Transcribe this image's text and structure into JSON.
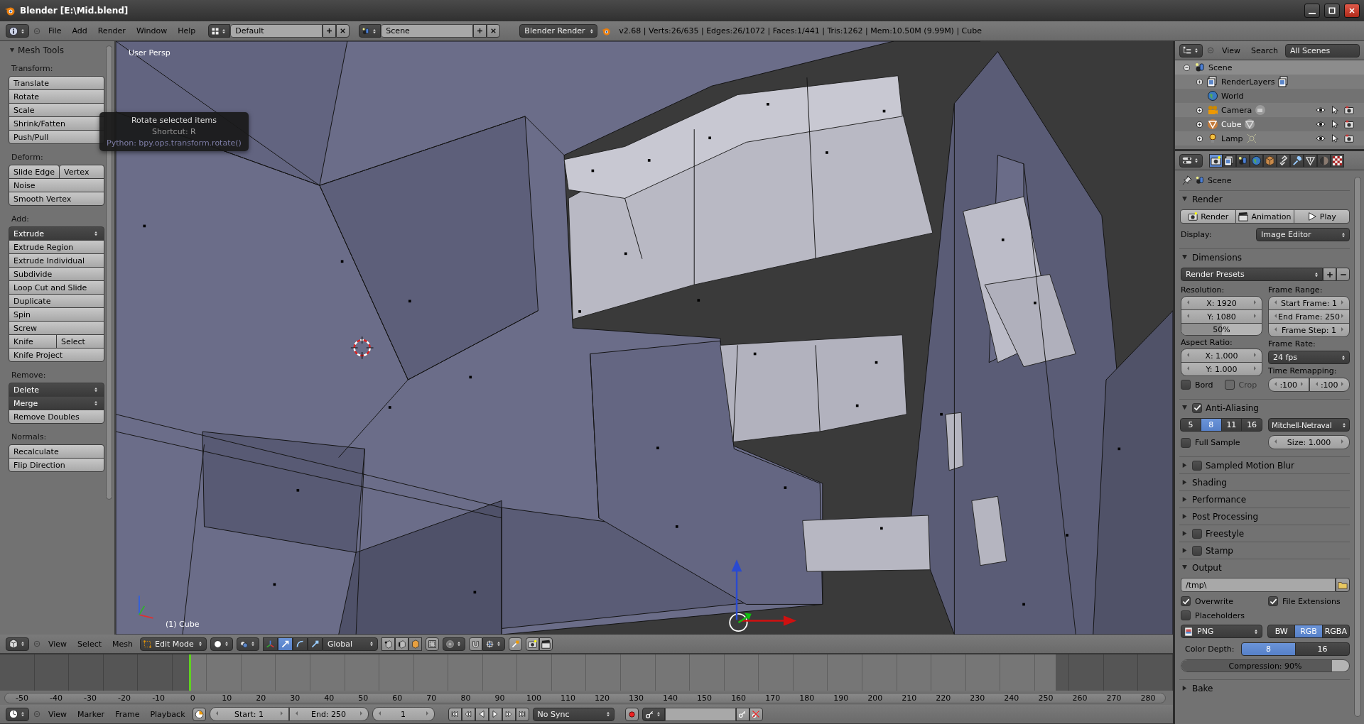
{
  "window": {
    "title": "Blender [E:\\Mid.blend]"
  },
  "info_header": {
    "menus": [
      "File",
      "Add",
      "Render",
      "Window",
      "Help"
    ],
    "layout": "Default",
    "scene": "Scene",
    "engine": "Blender Render",
    "stats": "v2.68 | Verts:26/635 | Edges:26/1072 | Faces:1/441 | Tris:1262 | Mem:10.50M (9.99M) | Cube"
  },
  "tool_shelf": {
    "title": "Mesh Tools",
    "sections": [
      {
        "label": "Transform:",
        "rows": [
          [
            {
              "label": "Translate",
              "kind": "button"
            }
          ],
          [
            {
              "label": "Rotate",
              "kind": "button"
            }
          ],
          [
            {
              "label": "Scale",
              "kind": "button"
            }
          ],
          [
            {
              "label": "Shrink/Fatten",
              "kind": "button"
            }
          ],
          [
            {
              "label": "Push/Pull",
              "kind": "button"
            }
          ]
        ]
      },
      {
        "label": "Deform:",
        "rows": [
          [
            {
              "label": "Slide Edge",
              "kind": "button"
            },
            {
              "label": "Vertex",
              "kind": "button"
            }
          ],
          [
            {
              "label": "Noise",
              "kind": "button"
            }
          ],
          [
            {
              "label": "Smooth Vertex",
              "kind": "button"
            }
          ]
        ]
      },
      {
        "label": "Add:",
        "rows": [
          [
            {
              "label": "Extrude",
              "kind": "dropdown"
            }
          ],
          [
            {
              "label": "Extrude Region",
              "kind": "button"
            }
          ],
          [
            {
              "label": "Extrude Individual",
              "kind": "button"
            }
          ],
          [
            {
              "label": "Subdivide",
              "kind": "button"
            }
          ],
          [
            {
              "label": "Loop Cut and Slide",
              "kind": "button"
            }
          ],
          [
            {
              "label": "Duplicate",
              "kind": "button"
            }
          ],
          [
            {
              "label": "Spin",
              "kind": "button"
            }
          ],
          [
            {
              "label": "Screw",
              "kind": "button"
            }
          ],
          [
            {
              "label": "Knife",
              "kind": "button"
            },
            {
              "label": "Select",
              "kind": "button"
            }
          ],
          [
            {
              "label": "Knife Project",
              "kind": "button"
            }
          ]
        ]
      },
      {
        "label": "Remove:",
        "rows": [
          [
            {
              "label": "Delete",
              "kind": "dropdown"
            }
          ],
          [
            {
              "label": "Merge",
              "kind": "dropdown"
            }
          ],
          [
            {
              "label": "Remove Doubles",
              "kind": "button"
            }
          ]
        ]
      },
      {
        "label": "Normals:",
        "rows": [
          [
            {
              "label": "Recalculate",
              "kind": "button"
            }
          ],
          [
            {
              "label": "Flip Direction",
              "kind": "button"
            }
          ]
        ]
      }
    ]
  },
  "tooltip": {
    "title": "Rotate selected items",
    "shortcut": "Shortcut: R",
    "python": "Python: bpy.ops.transform.rotate()"
  },
  "viewport": {
    "view_label": "User Persp",
    "object_label": "(1) Cube"
  },
  "viewport_header": {
    "menus": [
      "View",
      "Select",
      "Mesh"
    ],
    "mode": "Edit Mode",
    "orientation": "Global",
    "manipulators": [
      {
        "kind": "toggle",
        "selected": false
      },
      {
        "kind": "translate",
        "selected": true
      },
      {
        "kind": "rotate",
        "selected": false
      },
      {
        "kind": "scale",
        "selected": false
      }
    ],
    "select_modes": [
      {
        "kind": "vertex",
        "selected": false
      },
      {
        "kind": "edge",
        "selected": false
      },
      {
        "kind": "face",
        "selected": true
      }
    ]
  },
  "timeline": {
    "playhead": {
      "level": 0.162
    },
    "ticks": [
      "-50",
      "-40",
      "-30",
      "-20",
      "-10",
      "0",
      "10",
      "20",
      "30",
      "40",
      "50",
      "60",
      "70",
      "80",
      "90",
      "100",
      "110",
      "120",
      "130",
      "140",
      "150",
      "160",
      "170",
      "180",
      "190",
      "200",
      "210",
      "220",
      "230",
      "240",
      "250",
      "260",
      "270",
      "280"
    ]
  },
  "timeline_header": {
    "menus": [
      "View",
      "Marker",
      "Frame",
      "Playback"
    ],
    "start": "Start: 1",
    "end": "End: 250",
    "current": "1",
    "sync": "No Sync"
  },
  "outliner": {
    "menus": [
      "View",
      "Search"
    ],
    "filter": "All Scenes",
    "tree": [
      {
        "label": "Scene",
        "kind": "scene",
        "expanded": true,
        "children": [
          {
            "label": "RenderLayers",
            "kind": "render_layers",
            "expanded": false
          },
          {
            "label": "World",
            "kind": "world"
          },
          {
            "label": "Camera",
            "kind": "camera",
            "expanded": false
          },
          {
            "label": "Cube",
            "kind": "mesh",
            "expanded": false
          },
          {
            "label": "Lamp",
            "kind": "lamp",
            "expanded": false
          }
        ]
      }
    ]
  },
  "properties": {
    "context": "Scene",
    "tabs": [
      {
        "kind": "render",
        "selected": true
      },
      {
        "kind": "layers",
        "selected": false
      },
      {
        "kind": "scene",
        "selected": false
      },
      {
        "kind": "world",
        "selected": false
      },
      {
        "kind": "object",
        "selected": false
      },
      {
        "kind": "constraints",
        "selected": false
      },
      {
        "kind": "modifiers",
        "selected": false
      },
      {
        "kind": "data",
        "selected": false
      },
      {
        "kind": "material",
        "selected": false
      },
      {
        "kind": "texture",
        "selected": false
      }
    ],
    "panels": [
      {
        "kind": "render",
        "title": "Render",
        "expanded": true,
        "buttons": [
          "Render",
          "Animation",
          "Play"
        ],
        "display_label": "Display:",
        "display": "Image Editor"
      },
      {
        "kind": "dimensions",
        "title": "Dimensions",
        "expanded": true,
        "presets": "Render Presets",
        "resolution_label": "Resolution:",
        "res_x": "X: 1920",
        "res_y": "Y: 1080",
        "percentage": {
          "label": "50%",
          "level": 0.5
        },
        "range_label": "Frame Range:",
        "start": "Start Frame: 1",
        "end": "End Frame: 250",
        "step": "Frame Step: 1",
        "aspect_label": "Aspect Ratio:",
        "aspect_x": "X: 1.000",
        "aspect_y": "Y: 1.000",
        "rate_label": "Frame Rate:",
        "rate": "24 fps",
        "remap_label": "Time Remapping:",
        "remap_old": ":100",
        "remap_new": ":100",
        "border": {
          "label": "Bord",
          "checked": false,
          "disabled": false
        },
        "crop": {
          "label": "Crop",
          "checked": false,
          "disabled": true
        }
      },
      {
        "kind": "anti_aliasing",
        "title": "Anti-Aliasing",
        "expanded": true,
        "checked": true,
        "samples": [
          {
            "label": "5",
            "selected": false
          },
          {
            "label": "8",
            "selected": true
          },
          {
            "label": "11",
            "selected": false
          },
          {
            "label": "16",
            "selected": false
          }
        ],
        "filter": "Mitchell-Netraval",
        "full_sample": {
          "label": "Full Sample",
          "checked": false
        },
        "size": "Size: 1.000"
      },
      {
        "title": "Sampled Motion Blur",
        "expanded": false,
        "checked": false
      },
      {
        "title": "Shading",
        "expanded": false
      },
      {
        "title": "Performance",
        "expanded": false
      },
      {
        "title": "Post Processing",
        "expanded": false
      },
      {
        "title": "Freestyle",
        "expanded": false,
        "checked": false
      },
      {
        "title": "Stamp",
        "expanded": false,
        "checked": false
      },
      {
        "kind": "output",
        "title": "Output",
        "expanded": true,
        "path": "/tmp\\",
        "overwrite": {
          "label": "Overwrite",
          "checked": true
        },
        "extensions": {
          "label": "File Extensions",
          "checked": true
        },
        "placeholders": {
          "label": "Placeholders",
          "checked": false
        },
        "format": "PNG",
        "color_modes": [
          {
            "label": "BW",
            "selected": false
          },
          {
            "label": "RGB",
            "selected": true
          },
          {
            "label": "RGBA",
            "selected": false
          }
        ],
        "depth_label": "Color Depth:",
        "depths": [
          {
            "label": "8",
            "selected": true
          },
          {
            "label": "16",
            "selected": false
          }
        ],
        "compression": {
          "label": "Compression: 90%",
          "level": 0.9
        }
      },
      {
        "title": "Bake",
        "expanded": false
      }
    ]
  }
}
